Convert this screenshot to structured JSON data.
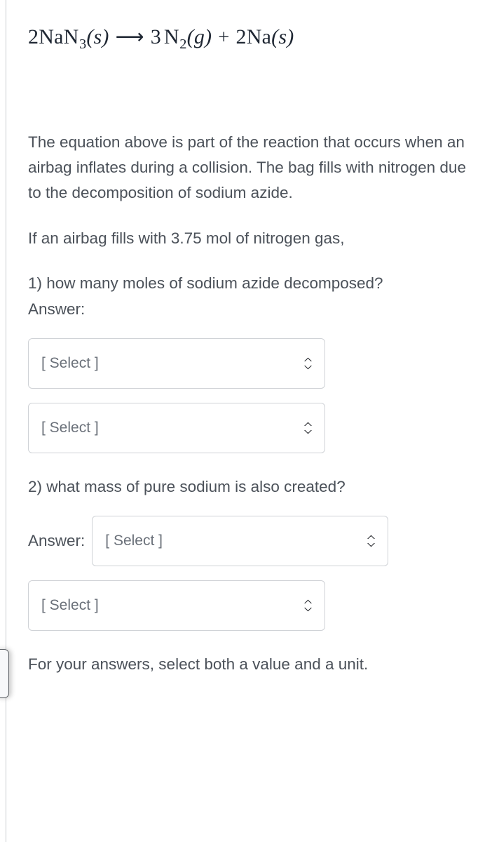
{
  "equation": {
    "reactant_coefficient": "2",
    "reactant_formula": "NaN",
    "reactant_subscript": "3",
    "reactant_state": "(s)",
    "arrow": "⟶",
    "product1_coefficient": "3",
    "product1_formula": "N",
    "product1_subscript": "2",
    "product1_state": "(g)",
    "plus": "+",
    "product2_coefficient": "2",
    "product2_formula": "Na",
    "product2_state": "(s)",
    "plain_text": "2NaN3(s) ⟶ 3 N2(g) + 2Na(s)"
  },
  "content": {
    "intro_paragraph": "The equation above is part of the reaction that occurs when an airbag inflates during a collision. The bag fills with nitrogen due to the decomposition of sodium azide.",
    "given_paragraph": "If an airbag fills with 3.75 mol of nitrogen gas,",
    "question1": "1) how many moles of sodium azide decomposed? Answer:",
    "question2": "2) what mass of pure sodium is also created?",
    "answer_label": "Answer:",
    "closing_paragraph": "For your answers, select both a value and a unit."
  },
  "selects": {
    "q1_value": {
      "value": "[ Select ]"
    },
    "q1_unit": {
      "value": "[ Select ]"
    },
    "q2_value": {
      "value": "[ Select ]"
    },
    "q2_unit": {
      "value": "[ Select ]"
    }
  },
  "icons": {
    "chevron": "select-chevron-up-down-icon"
  },
  "colors": {
    "background": "#ffffff",
    "body_text": "#4b5159",
    "equation_text": "#1f2733",
    "placeholder_text": "#6a7079",
    "select_border": "#cfd2d6",
    "rule": "#c9ccd0"
  }
}
